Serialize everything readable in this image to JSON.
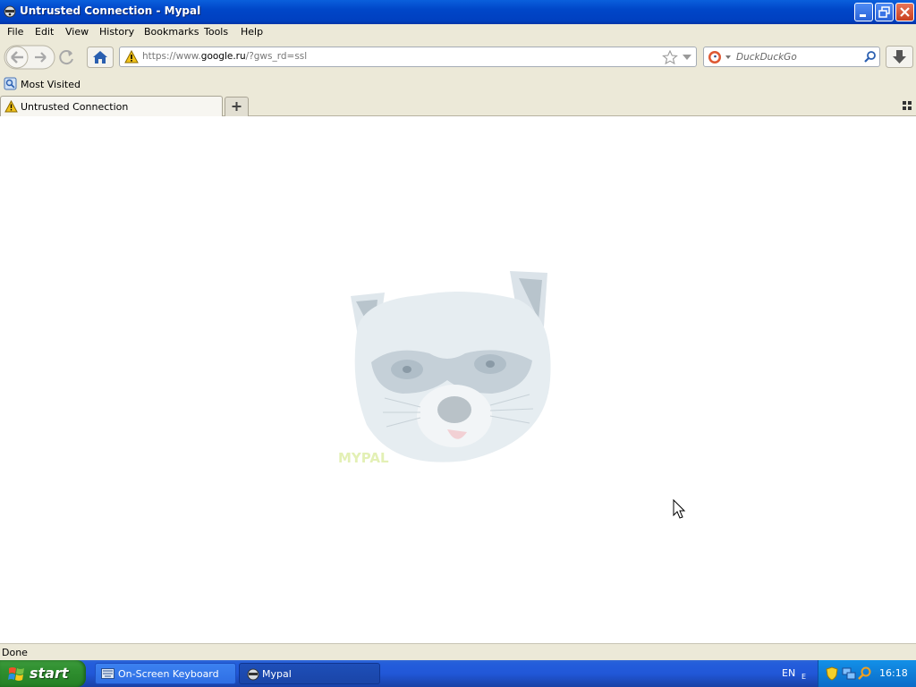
{
  "window": {
    "title": "Untrusted Connection - Mypal"
  },
  "menu": {
    "items": [
      "File",
      "Edit",
      "View",
      "History",
      "Bookmarks",
      "Tools",
      "Help"
    ]
  },
  "navbar": {
    "url_prefix": "https://www.",
    "url_domain": "google.ru",
    "url_suffix": "/?gws_rd=ssl",
    "search_engine": "DuckDuckGo"
  },
  "bookmarks": {
    "most_visited": "Most Visited"
  },
  "tabs": [
    {
      "label": "Untrusted Connection"
    }
  ],
  "content": {
    "logo_text": "MYPAL"
  },
  "status": {
    "text": "Done"
  },
  "taskbar": {
    "start_label": "start",
    "items": [
      "On-Screen Keyboard",
      "Mypal"
    ],
    "language": "EN",
    "clock": "16:18"
  },
  "colors": {
    "title_blue": "#0046c8",
    "chrome_beige": "#ece9d8",
    "start_green": "#2f8f2f",
    "tray_blue": "#0f7ed8"
  }
}
